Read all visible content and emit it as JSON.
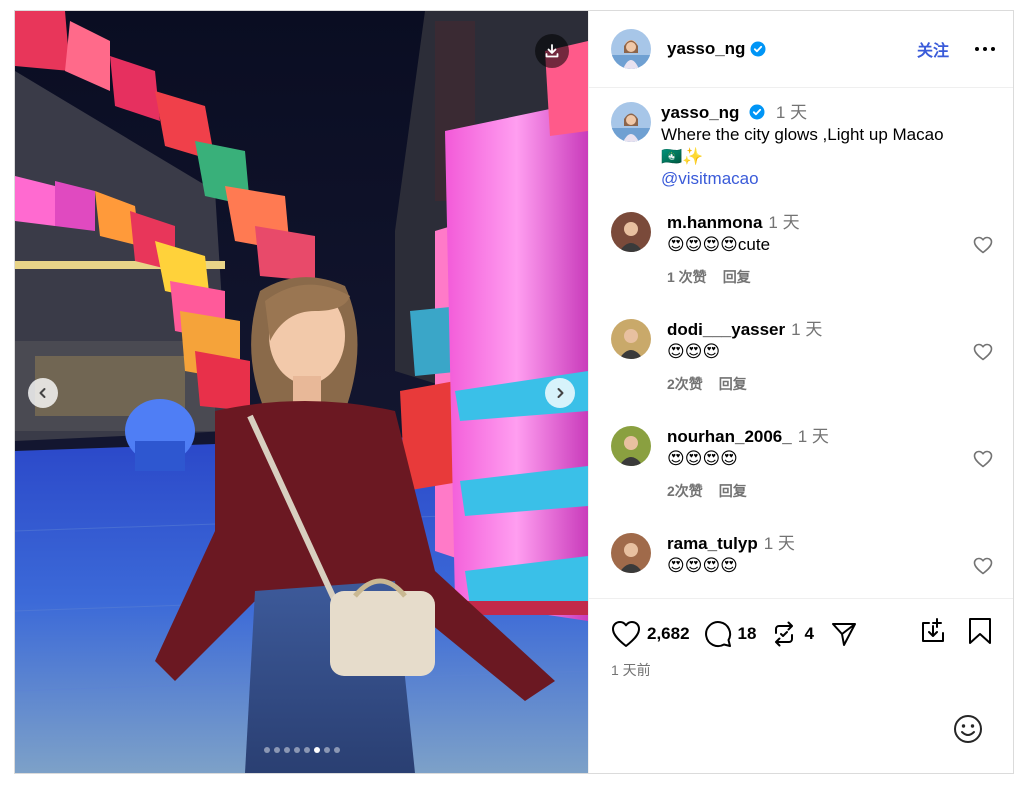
{
  "post": {
    "username": "yasso_ng",
    "follow_label": "关注",
    "caption": {
      "time": "1 天",
      "text": "Where the city glows ,Light up Macao",
      "emoji_line": "🇲🇴✨",
      "mention": "@visitmacao"
    },
    "carousel": {
      "total_slides": 8,
      "active_index": 5
    },
    "comments": [
      {
        "username": "m.hanmona",
        "time": "1 天",
        "text": "😍😍😍😍cute",
        "likes": "1 次赞",
        "reply": "回复"
      },
      {
        "username": "dodi___yasser",
        "time": "1 天",
        "text": "😍😍😍",
        "likes": "2次赞",
        "reply": "回复"
      },
      {
        "username": "nourhan_2006_",
        "time": "1 天",
        "text": "😍😍😍😍",
        "likes": "2次赞",
        "reply": "回复"
      },
      {
        "username": "rama_tulyp",
        "time": "1 天",
        "text": "😍😍😍😍",
        "likes": "",
        "reply": ""
      }
    ],
    "stats": {
      "likes": "2,682",
      "comments": "18",
      "reposts": "4"
    },
    "time_ago": "1 天前"
  },
  "colors": {
    "accent": "#3a5bd9",
    "verified": "#0095f6",
    "muted": "#737373",
    "border": "#dbdbdb"
  },
  "icons": [
    "download-icon",
    "chevron-left-icon",
    "chevron-right-icon",
    "verified-badge-icon",
    "more-icon",
    "heart-icon",
    "comment-icon",
    "repost-icon",
    "share-icon",
    "save-icon",
    "bookmark-icon",
    "emoji-icon"
  ]
}
